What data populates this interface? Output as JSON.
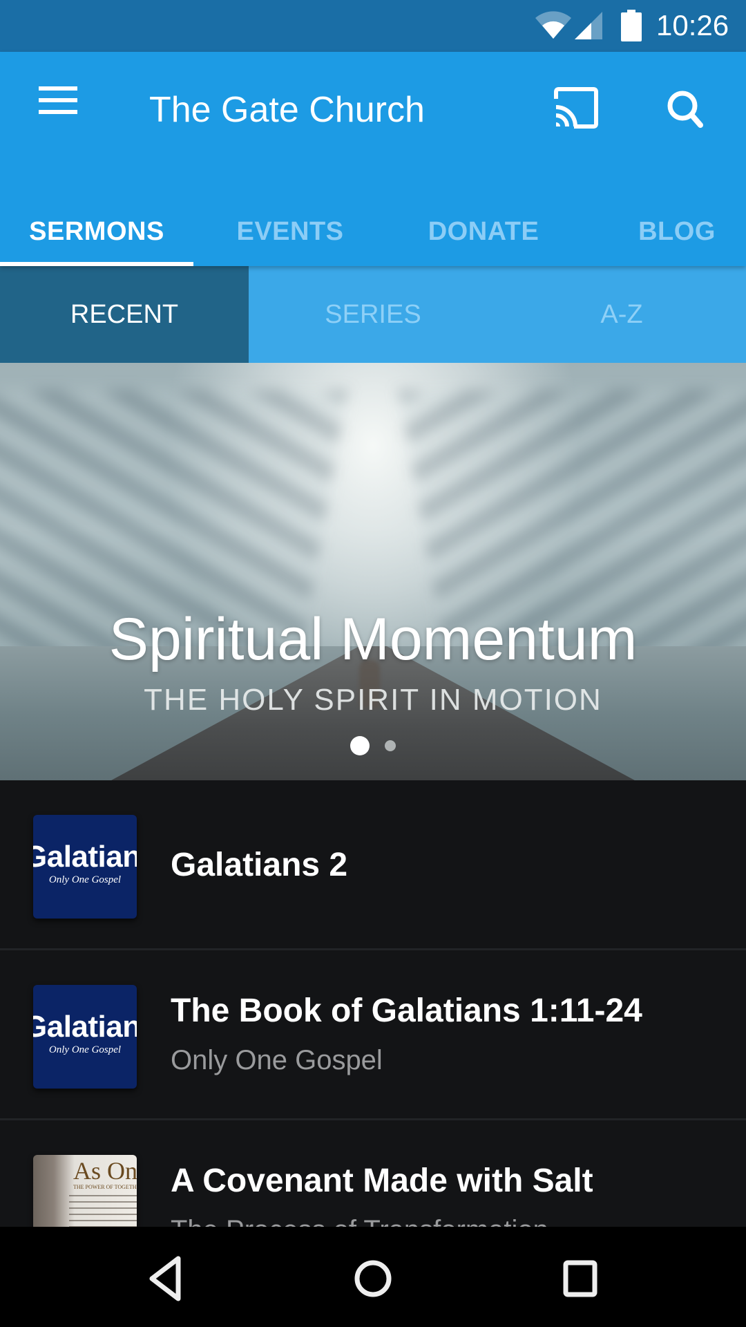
{
  "status_bar": {
    "time": "10:26",
    "icons": [
      "wifi-icon",
      "cellular-signal-icon",
      "battery-icon"
    ]
  },
  "app_bar": {
    "title": "The Gate Church",
    "menu_icon": "hamburger-menu-icon",
    "cast_icon": "cast-icon",
    "search_icon": "search-icon"
  },
  "tabs": [
    {
      "label": "SERMONS",
      "active": true
    },
    {
      "label": "EVENTS",
      "active": false
    },
    {
      "label": "DONATE",
      "active": false
    },
    {
      "label": "BLOG",
      "active": false
    }
  ],
  "sub_tabs": [
    {
      "label": "RECENT",
      "active": true
    },
    {
      "label": "SERIES",
      "active": false
    },
    {
      "label": "A-Z",
      "active": false
    }
  ],
  "hero": {
    "title": "Spiritual Momentum",
    "subtitle": "THE HOLY SPIRIT IN MOTION",
    "page_count": 2,
    "current_page": 1
  },
  "sermons": [
    {
      "title": "Galatians 2",
      "subtitle": "",
      "thumbnail": {
        "text": "Galatians",
        "caption": "Only One Gospel"
      }
    },
    {
      "title": "The Book of Galatians 1:11-24",
      "subtitle": "Only One Gospel",
      "thumbnail": {
        "text": "Galatians",
        "caption": "Only One Gospel"
      }
    },
    {
      "title": "A Covenant Made with Salt",
      "subtitle": "The Process of Transformation",
      "thumbnail": {
        "text": "As One",
        "caption": "THE POWER OF TOGETHERNESS"
      }
    }
  ],
  "nav_bar": {
    "back_icon": "back-icon",
    "home_icon": "home-icon",
    "recents_icon": "recents-icon"
  },
  "colors": {
    "status_bar": "#1a6ea6",
    "app_bar": "#1d9be4",
    "sub_tabs": "#3ba8e8",
    "sub_tab_active": "#216488",
    "list_background": "#131416",
    "thumbnail_blue": "#0b2466"
  }
}
